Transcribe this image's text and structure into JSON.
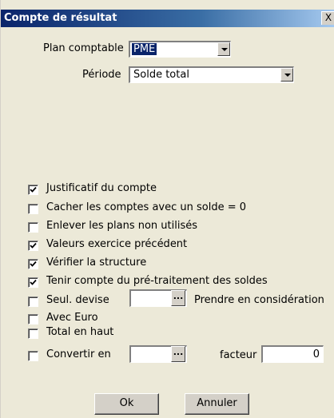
{
  "window": {
    "title": "Compte de résultat",
    "close_label": "X"
  },
  "plan": {
    "label": "Plan comptable",
    "value": "PME"
  },
  "periode": {
    "label": "Période",
    "value": "Solde total"
  },
  "options": [
    {
      "label": "Justificatif du compte",
      "checked": true
    },
    {
      "label": "Cacher les comptes avec un solde = 0",
      "checked": false
    },
    {
      "label": "Enlever les plans non utilisés",
      "checked": false
    },
    {
      "label": "Valeurs exercice précédent",
      "checked": true
    },
    {
      "label": "Vérifier la structure",
      "checked": true
    },
    {
      "label": "Tenir compte du pré-traitement des soldes",
      "checked": true
    },
    {
      "label": "Seul. devise",
      "checked": false
    },
    {
      "label": "Avec Euro",
      "checked": false
    },
    {
      "label": "Total en haut",
      "checked": false
    },
    {
      "label": "Convertir en",
      "checked": false
    }
  ],
  "devise": {
    "value": "",
    "browse_label": "...",
    "extra_label": "Prendre en considération"
  },
  "convertir": {
    "value": "",
    "browse_label": "...",
    "facteur_label": "facteur",
    "facteur_value": "0"
  },
  "buttons": {
    "ok": "Ok",
    "cancel": "Annuler"
  }
}
